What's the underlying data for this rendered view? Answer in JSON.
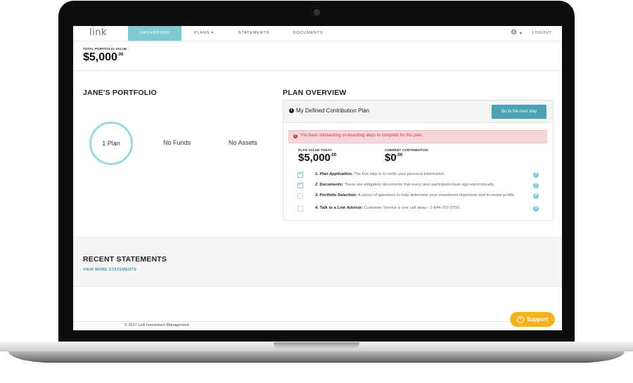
{
  "nav": {
    "logo": "link",
    "items": [
      "DASHBOARD",
      "PLANS ▾",
      "STATEMENTS",
      "DOCUMENTS"
    ],
    "settings_icon": "gear-icon",
    "logout": "LOGOUT"
  },
  "summary": {
    "label": "TOTAL PORTFOLIO VALUE",
    "value": "$5,000",
    "cents": ".00"
  },
  "portfolio": {
    "title": "JANE'S PORTFOLIO",
    "plans": "1 Plan",
    "funds": "No Funds",
    "assets": "No Assets"
  },
  "plan_overview": {
    "title": "PLAN OVERVIEW",
    "card_title": "My Defined Contribution Plan",
    "next_step_button": "Go to the next step",
    "alert": "You have outstanding on-boarding steps to complete for this plan.",
    "plan_value_label": "PLAN VALUE TODAY",
    "plan_value": "$5,000",
    "plan_value_cents": ".00",
    "contribution_label": "CURRENT CONTRIBUTION",
    "contribution_value": "$0",
    "contribution_cents": ".00",
    "steps": [
      {
        "title": "1. Plan Application:",
        "text": "The first step is to verify your personal information.",
        "done": true
      },
      {
        "title": "2. Documents:",
        "text": "These are obligatory documents that every plan participant must sign electronically.",
        "done": true
      },
      {
        "title": "3. Portfolio Selection:",
        "text": "A series of questions to help determine your investment objectives and in-vestor profile.",
        "done": false
      },
      {
        "title": "4. Talk to a Link Advisor:",
        "text": "Customer Service is one call away - 1-844-707-3700.",
        "done": false
      }
    ]
  },
  "recent": {
    "title": "RECENT STATEMENTS",
    "link": "VIEW MORE STATEMENTS"
  },
  "footer": {
    "copyright": "© 2017 Link Investment Management"
  },
  "support": {
    "label": "Support"
  },
  "colors": {
    "accent": "#7fc9d5",
    "button": "#4aa3b1",
    "alert_text": "#c23b43",
    "alert_bg": "#f6d6d8",
    "support": "#f6b11e"
  }
}
